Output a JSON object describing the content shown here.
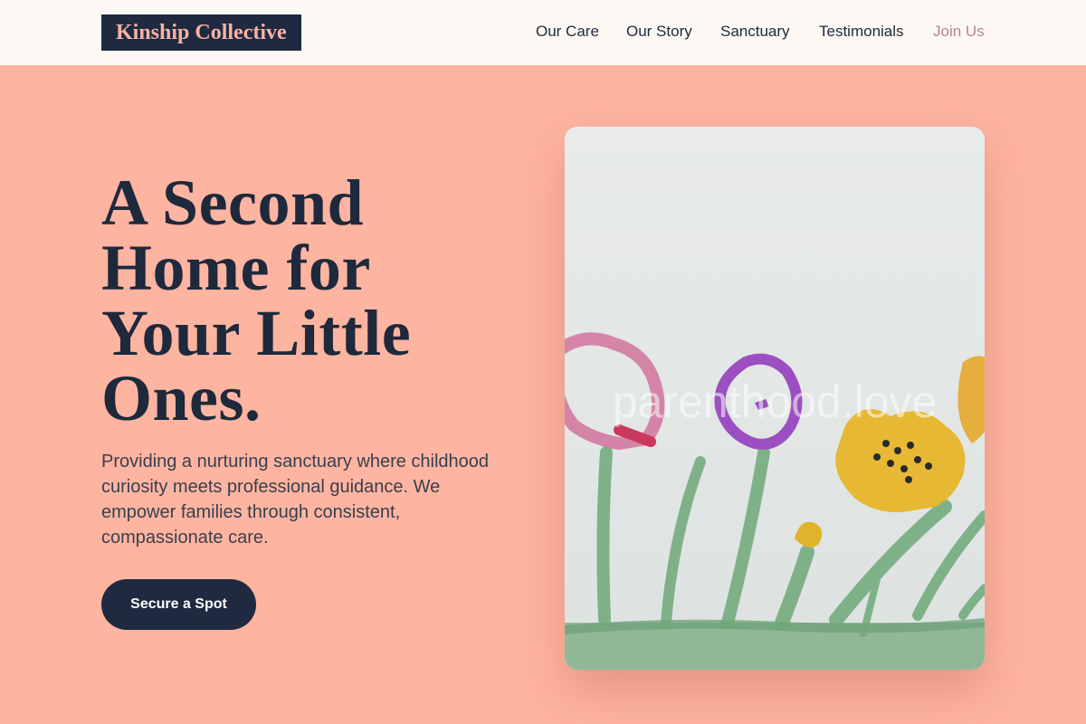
{
  "header": {
    "brand": "Kinship Collective",
    "nav": [
      {
        "label": "Our Care"
      },
      {
        "label": "Our Story"
      },
      {
        "label": "Sanctuary"
      },
      {
        "label": "Testimonials"
      },
      {
        "label": "Join Us"
      }
    ]
  },
  "hero": {
    "headline_lines": [
      "A Second",
      "Home for",
      "Your Little",
      "Ones."
    ],
    "description_lines": [
      "Providing a nurturing sanctuary where childhood",
      "curiosity meets professional guidance. We",
      "empower families through consistent,",
      "compassionate care."
    ],
    "cta_label": "Secure a Spot"
  },
  "image": {
    "subject": "child watercolor painting of flowers and grass",
    "watermark": "parenthood.love"
  },
  "colors": {
    "background": "#fdb4a1",
    "header": "#fdf8f4",
    "brand_bg": "#1f2a40",
    "brand_text": "#f7b3a2",
    "ink": "#1e293b",
    "nav_muted": "#b6868a",
    "button": "#1f2a40"
  }
}
